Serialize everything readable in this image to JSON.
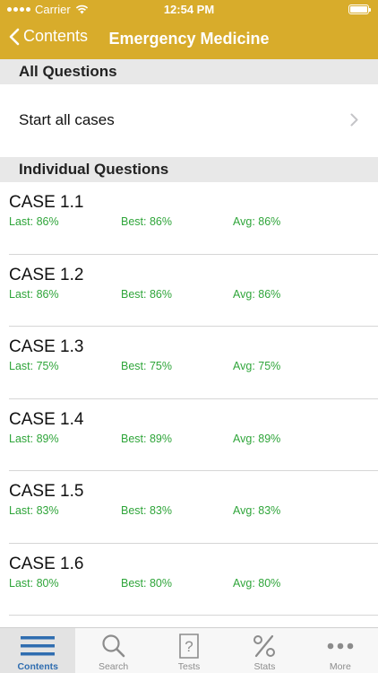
{
  "status": {
    "carrier": "Carrier",
    "time": "12:54 PM"
  },
  "nav": {
    "back_label": "Contents",
    "title": "Emergency Medicine"
  },
  "sections": {
    "all": "All Questions",
    "individual": "Individual Questions"
  },
  "start_all": {
    "label": "Start all cases"
  },
  "cases": [
    {
      "title": "CASE 1.1",
      "last": "Last: 86%",
      "best": "Best: 86%",
      "avg": "Avg: 86%"
    },
    {
      "title": "CASE 1.2",
      "last": "Last: 86%",
      "best": "Best: 86%",
      "avg": "Avg: 86%"
    },
    {
      "title": "CASE 1.3",
      "last": "Last: 75%",
      "best": "Best: 75%",
      "avg": "Avg: 75%"
    },
    {
      "title": "CASE 1.4",
      "last": "Last: 89%",
      "best": "Best: 89%",
      "avg": "Avg: 89%"
    },
    {
      "title": "CASE 1.5",
      "last": "Last: 83%",
      "best": "Best: 83%",
      "avg": "Avg: 83%"
    },
    {
      "title": "CASE 1.6",
      "last": "Last: 80%",
      "best": "Best: 80%",
      "avg": "Avg: 80%"
    }
  ],
  "tabs": [
    {
      "label": "Contents",
      "icon": "list-icon"
    },
    {
      "label": "Search",
      "icon": "search-icon"
    },
    {
      "label": "Tests",
      "icon": "question-icon"
    },
    {
      "label": "Stats",
      "icon": "percent-icon"
    },
    {
      "label": "More",
      "icon": "more-icon"
    }
  ],
  "colors": {
    "accent": "#d8ac2b",
    "stat_green": "#2fa53a",
    "active_tab": "#2f6db0"
  }
}
